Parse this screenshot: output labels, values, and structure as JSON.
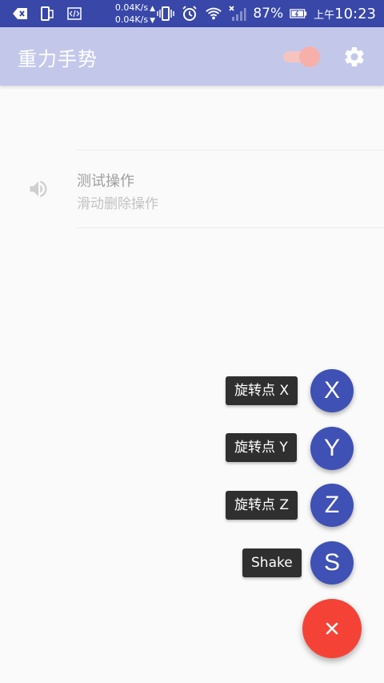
{
  "status_bar": {
    "speed_up": "0.04K/s",
    "speed_down": "0.04K/s",
    "battery": "87%",
    "time_prefix": "上午",
    "time": "10:23",
    "icons": [
      "back-arrow-icon",
      "phone-mirror-icon",
      "code-icon",
      "vibrate-icon",
      "alarm-icon",
      "wifi-icon",
      "signal-icon",
      "battery-icon"
    ]
  },
  "app_bar": {
    "title": "重力手势",
    "toggle_on": true,
    "settings_icon": "gear-icon"
  },
  "list": {
    "items": [
      {
        "title": "测试操作",
        "subtitle": "滑动删除操作",
        "icon": "speaker-icon"
      }
    ]
  },
  "fab_menu": {
    "items": [
      {
        "label": "旋转点 X",
        "letter": "X"
      },
      {
        "label": "旋转点 Y",
        "letter": "Y"
      },
      {
        "label": "旋转点 Z",
        "letter": "Z"
      },
      {
        "label": "Shake",
        "letter": "S"
      }
    ],
    "main_icon": "close-icon"
  },
  "colors": {
    "status_bar": "#3847a8",
    "app_bar": "#c3c8eb",
    "fab_mini": "#3f51b5",
    "fab_main": "#f44336"
  }
}
